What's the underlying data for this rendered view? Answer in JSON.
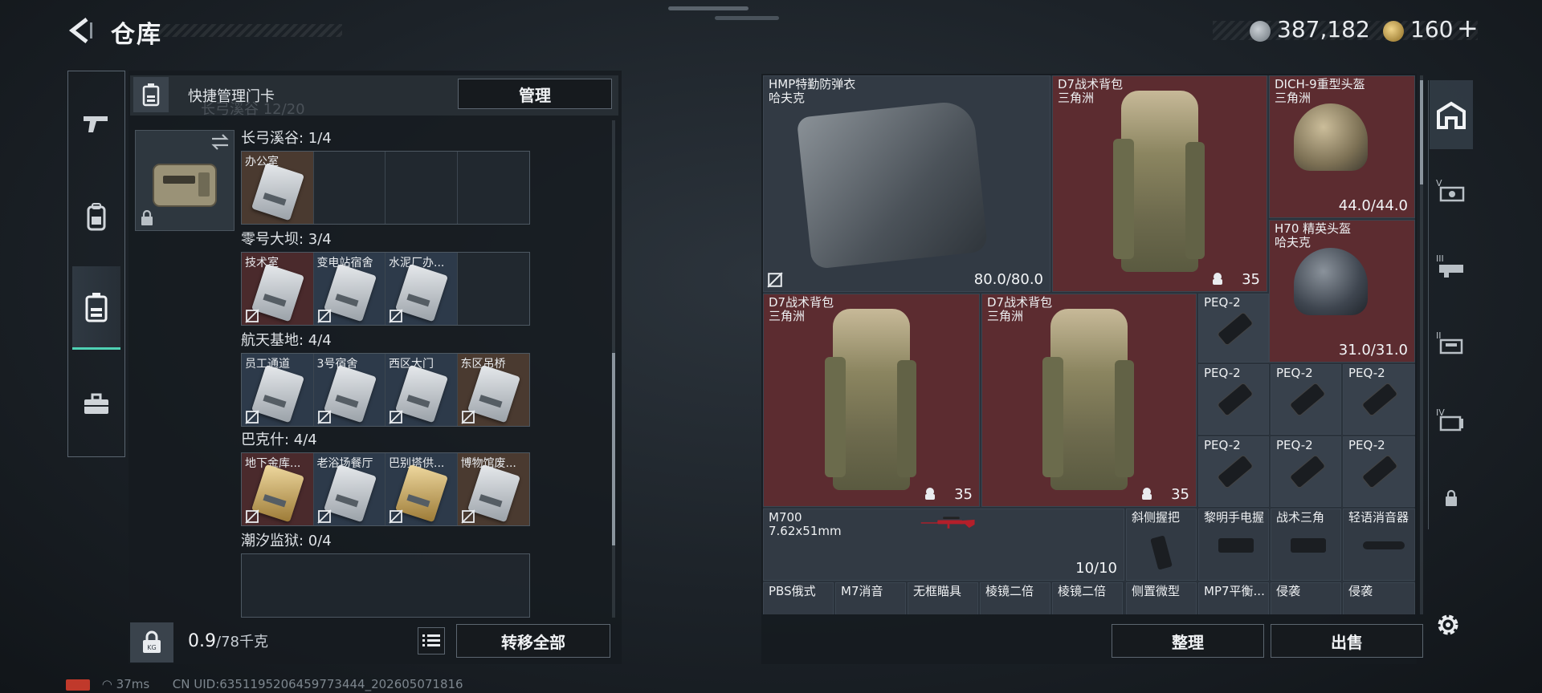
{
  "header": {
    "title": "仓库",
    "currency_silver": "387,182",
    "currency_gold": "160",
    "plus_label": "+"
  },
  "left_rail": {
    "tabs": [
      {
        "icon": "pistol-icon",
        "active": false
      },
      {
        "icon": "backpack-icon",
        "active": false
      },
      {
        "icon": "keycard-icon",
        "active": true
      },
      {
        "icon": "toolbox-icon",
        "active": false
      }
    ]
  },
  "keycards": {
    "header_title": "快捷管理门卡",
    "manage_label": "管理",
    "faded_text": "长弓溪谷  12/20",
    "zones": [
      {
        "label": "长弓溪谷: 1/4",
        "cells": [
          {
            "name": "办公室",
            "color": "brown",
            "gold": false
          },
          {
            "name": "",
            "color": "empty"
          },
          {
            "name": "",
            "color": "empty"
          },
          {
            "name": "",
            "color": "empty"
          }
        ]
      },
      {
        "label": "零号大坝: 3/4",
        "cells": [
          {
            "name": "技术室",
            "color": "red"
          },
          {
            "name": "变电站宿舍",
            "color": "blue"
          },
          {
            "name": "水泥厂办...",
            "color": "blue"
          },
          {
            "name": "",
            "color": "empty"
          }
        ]
      },
      {
        "label": "航天基地: 4/4",
        "cells": [
          {
            "name": "员工通道",
            "color": "blue"
          },
          {
            "name": "3号宿舍",
            "color": "blue"
          },
          {
            "name": "西区大门",
            "color": "blue"
          },
          {
            "name": "东区吊桥",
            "color": "brown"
          }
        ]
      },
      {
        "label": "巴克什: 4/4",
        "cells": [
          {
            "name": "地下金库...",
            "color": "red",
            "gold": true
          },
          {
            "name": "老浴场餐厅",
            "color": "blue"
          },
          {
            "name": "巴别塔供...",
            "color": "blue"
          },
          {
            "name": "博物馆废...",
            "color": "brown"
          }
        ]
      },
      {
        "label": "潮汐监狱: 0/4",
        "cells": []
      }
    ]
  },
  "left_footer": {
    "weight_value": "0.9",
    "weight_max": "/78千克",
    "transfer_label": "转移全部"
  },
  "stash": {
    "items": [
      {
        "name": "HMP特勤防弹衣",
        "sub": "哈夫克",
        "value": "80.0/80.0",
        "color": "dark"
      },
      {
        "name": "D7战术背包",
        "sub": "三角洲",
        "value": "35",
        "color": "red"
      },
      {
        "name": "DICH-9重型头盔",
        "sub": "三角洲",
        "value": "44.0/44.0",
        "color": "red"
      },
      {
        "name": "H70 精英头盔",
        "sub": "哈夫克",
        "value": "31.0/31.0",
        "color": "red"
      },
      {
        "name": "D7战术背包",
        "sub": "三角洲",
        "value": "35",
        "color": "red"
      },
      {
        "name": "D7战术背包",
        "sub": "三角洲",
        "value": "35",
        "color": "red"
      },
      {
        "name": "PEQ-2",
        "color": "dark"
      },
      {
        "name": "PEQ-2",
        "color": "dark"
      },
      {
        "name": "PEQ-2",
        "color": "dark"
      },
      {
        "name": "PEQ-2",
        "color": "dark"
      },
      {
        "name": "PEQ-2",
        "color": "dark"
      },
      {
        "name": "PEQ-2",
        "color": "dark"
      },
      {
        "name": "PEQ-2",
        "color": "dark"
      },
      {
        "name": "M700",
        "sub": "7.62x51mm",
        "value": "10/10",
        "color": "dark"
      },
      {
        "name": "斜侧握把",
        "color": "dark"
      },
      {
        "name": "黎明手电握",
        "color": "dark"
      },
      {
        "name": "战术三角",
        "color": "dark"
      },
      {
        "name": "轻语消音器",
        "color": "dark"
      },
      {
        "name": "PBS俄式",
        "color": "dark"
      },
      {
        "name": "M7消音",
        "color": "dark"
      },
      {
        "name": "无框瞄具",
        "color": "dark"
      },
      {
        "name": "棱镜二倍",
        "color": "dark"
      },
      {
        "name": "棱镜二倍",
        "color": "dark"
      },
      {
        "name": "侧置微型",
        "color": "dark"
      },
      {
        "name": "MP7平衡...",
        "color": "dark"
      },
      {
        "name": "侵袭",
        "color": "dark"
      },
      {
        "name": "侵袭",
        "color": "dark"
      }
    ],
    "sort_label": "整理",
    "sell_label": "出售"
  },
  "right_rail": {
    "tabs": [
      {
        "icon": "home-base-icon",
        "active": true
      },
      {
        "icon": "storage-v-icon"
      },
      {
        "icon": "storage-iii-icon"
      },
      {
        "icon": "storage-ii-icon"
      },
      {
        "icon": "storage-iv-icon"
      },
      {
        "icon": "lock-icon"
      }
    ]
  },
  "status_bar": {
    "ping": "37ms",
    "uid": "CN UID:6351195206459773444_202605071816"
  },
  "colors": {
    "accent": "#4fd1b4",
    "item_red": "#5c2c30",
    "item_dark": "#323a44"
  }
}
